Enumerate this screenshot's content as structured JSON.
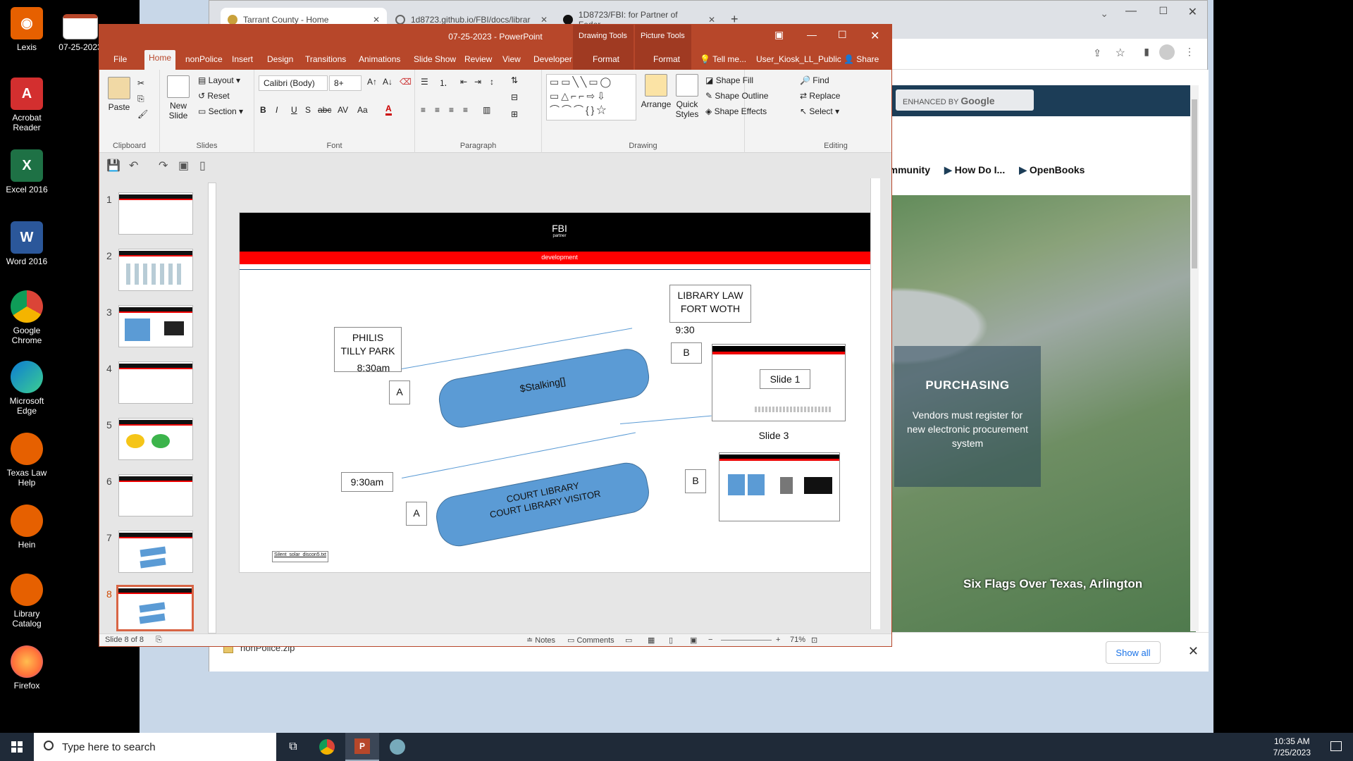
{
  "desktop": {
    "icons": [
      {
        "label": "Lexis",
        "color": "#e66000"
      },
      {
        "label": "Acrobat Reader",
        "color": "#d32f2f"
      },
      {
        "label": "Excel 2016",
        "color": "#1e7145"
      },
      {
        "label": "Word 2016",
        "color": "#2b579a"
      },
      {
        "label": "Google Chrome",
        "color": "#4285f4"
      },
      {
        "label": "Microsoft Edge",
        "color": "#0c7bd4"
      },
      {
        "label": "Texas Law Help",
        "color": "#e66000"
      },
      {
        "label": "Hein",
        "color": "#e66000"
      },
      {
        "label": "Library Catalog",
        "color": "#e66000"
      },
      {
        "label": "Firefox",
        "color": "#ff7139"
      }
    ],
    "file_icon": {
      "label": "07-25-2023"
    }
  },
  "chrome": {
    "tabs": [
      {
        "title": "Tarrant County - Home"
      },
      {
        "title": "1d8723.github.io/FBI/docs/librar"
      },
      {
        "title": "1D8723/FBI: for Partner of Feder"
      }
    ],
    "site": {
      "google_label": "ENHANCED BY",
      "google_brand": "Google",
      "nav": [
        "mmunity",
        "How Do I...",
        "OpenBooks"
      ],
      "purchasing_title": "PURCHASING",
      "purchasing_text": "Vendors must register for new electronic procurement system",
      "hero_caption": "Six Flags Over Texas, Arlington"
    },
    "download": {
      "filename": "nonPolice.zip",
      "show_all": "Show all"
    }
  },
  "ppt": {
    "title": "07-25-2023 - PowerPoint",
    "context_groups": [
      "Drawing Tools",
      "Picture Tools"
    ],
    "tabs": [
      "File",
      "Home",
      "nonPolice",
      "Insert",
      "Design",
      "Transitions",
      "Animations",
      "Slide Show",
      "Review",
      "View",
      "Developer",
      "Format",
      "Format"
    ],
    "tell_me": "Tell me...",
    "user": "User_Kiosk_LL_Public",
    "share": "Share",
    "ribbon": {
      "clipboard": {
        "label": "Clipboard",
        "paste": "Paste"
      },
      "slides": {
        "label": "Slides",
        "new_slide": "New Slide",
        "layout": "Layout",
        "reset": "Reset",
        "section": "Section"
      },
      "font": {
        "label": "Font",
        "font_name": "Calibri (Body)",
        "font_size": "8+"
      },
      "paragraph": {
        "label": "Paragraph"
      },
      "drawing": {
        "label": "Drawing",
        "arrange": "Arrange",
        "quick_styles": "Quick Styles",
        "shape_fill": "Shape Fill",
        "shape_outline": "Shape Outline",
        "shape_effects": "Shape Effects"
      },
      "editing": {
        "label": "Editing",
        "find": "Find",
        "replace": "Replace",
        "select": "Select"
      }
    },
    "slide": {
      "header_title": "FBI",
      "header_sub": "partner",
      "red_band": "development",
      "text_philis": "PHILIS\nTILLY PARK",
      "text_830": "8:30am",
      "text_a1": "A",
      "cyl1": "$Stalking[]",
      "text_library": "LIBRARY LAW\nFORT WOTH",
      "text_930a": "9:30",
      "text_b1": "B",
      "slide1_label": "Slide 1",
      "slide3_label": "Slide 3",
      "text_930b": "9:30am",
      "text_a2": "A",
      "cyl2": "COURT LIBRARY\nCOURT LIBRARY VISITOR",
      "text_b2": "B",
      "small_text": "Silent_solar_discon5.txt"
    },
    "thumbnails": [
      "1",
      "2",
      "3",
      "4",
      "5",
      "6",
      "7",
      "8"
    ],
    "status": {
      "slide_info": "Slide 8 of 8",
      "notes": "Notes",
      "comments": "Comments",
      "zoom": "71%"
    }
  },
  "taskbar": {
    "search_placeholder": "Type here to search",
    "time": "10:35 AM",
    "date": "7/25/2023"
  }
}
